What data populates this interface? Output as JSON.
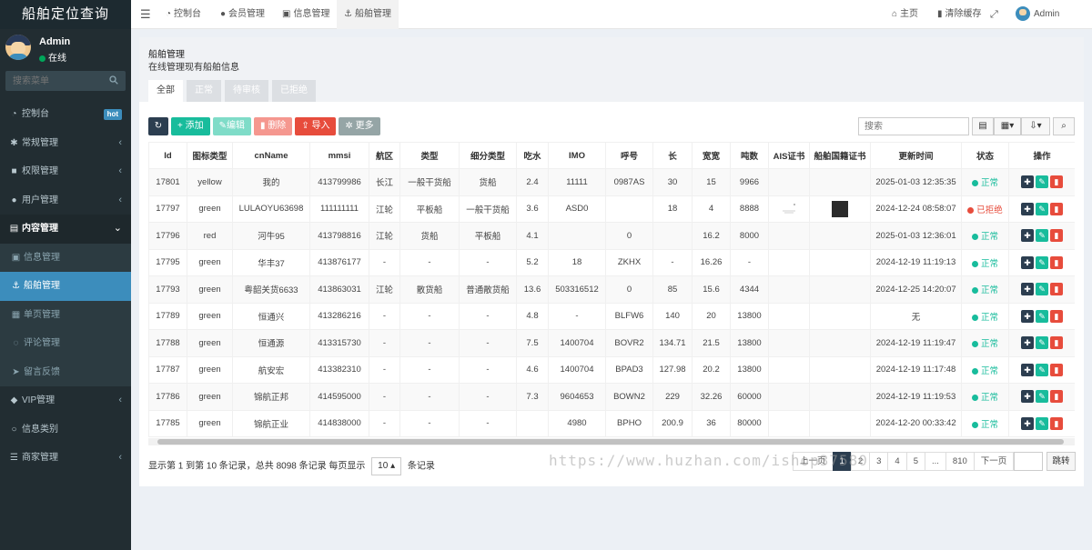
{
  "app": {
    "title": "船舶定位查询"
  },
  "user": {
    "name": "Admin",
    "status": "在线"
  },
  "sidebar": {
    "search_placeholder": "搜索菜单",
    "items": [
      {
        "label": "控制台",
        "icon": "dashboard-icon",
        "badge": "hot"
      },
      {
        "label": "常规管理",
        "icon": "cogs-icon"
      },
      {
        "label": "权限管理",
        "icon": "group-icon"
      },
      {
        "label": "用户管理",
        "icon": "user-circle-icon"
      },
      {
        "label": "内容管理",
        "icon": "file-icon"
      },
      {
        "label": "信息管理",
        "icon": "image-icon"
      },
      {
        "label": "船舶管理",
        "icon": "anchor-icon"
      },
      {
        "label": "单页管理",
        "icon": "file-text-icon"
      },
      {
        "label": "评论管理",
        "icon": "comment-icon"
      },
      {
        "label": "留言反馈",
        "icon": "paper-plane-icon"
      },
      {
        "label": "VIP管理",
        "icon": "diamond-icon"
      },
      {
        "label": "信息类别",
        "icon": "circle-icon"
      },
      {
        "label": "商家管理",
        "icon": "list-icon"
      }
    ]
  },
  "topbar": {
    "tabs": [
      "控制台",
      "会员管理",
      "信息管理",
      "船舶管理"
    ],
    "home": "主页",
    "clear_cache": "清除缓存",
    "user": "Admin"
  },
  "page": {
    "title": "船舶管理",
    "subtitle": "在线管理现有船舶信息",
    "tabs": [
      "全部",
      "正常",
      "待审核",
      "已拒绝"
    ]
  },
  "toolbar": {
    "add": "添加",
    "edit": "编辑",
    "delete": "删除",
    "import": "导入",
    "more": "更多",
    "search_placeholder": "搜索"
  },
  "table": {
    "columns": [
      "Id",
      "图标类型",
      "cnName",
      "mmsi",
      "航区",
      "类型",
      "细分类型",
      "吃水",
      "IMO",
      "呼号",
      "长",
      "宽宽",
      "吨数",
      "AIS证书",
      "船舶国籍证书",
      "更新时间",
      "状态",
      "操作"
    ],
    "rows": [
      [
        "17801",
        "yellow",
        "我的",
        "413799986",
        "长江",
        "一般干货船",
        "货船",
        "2.4",
        "11111",
        "0987AS",
        "30",
        "15",
        "9966",
        "",
        "",
        "2025-01-03 12:35:35",
        "正常"
      ],
      [
        "17797",
        "green",
        "LULAOYU63698",
        "111111111",
        "江轮",
        "平板船",
        "一般干货船",
        "3.6",
        "ASD0",
        "",
        "18",
        "4",
        "8888",
        "",
        "",
        "2024-12-24 08:58:07",
        "已拒绝"
      ],
      [
        "17796",
        "red",
        "河牛95",
        "413798816",
        "江轮",
        "货船",
        "平板船",
        "4.1",
        "",
        "0",
        "",
        "16.2",
        "8000",
        "",
        "",
        "2025-01-03 12:36:01",
        "正常"
      ],
      [
        "17795",
        "green",
        "华丰37",
        "413876177",
        "-",
        "-",
        "-",
        "5.2",
        "18",
        "ZKHX",
        "-",
        "16.26",
        "-",
        "",
        "",
        "2024-12-19 11:19:13",
        "正常"
      ],
      [
        "17793",
        "green",
        "粤韶关货6633",
        "413863031",
        "江轮",
        "散货船",
        "普通散货船",
        "13.6",
        "503316512",
        "0",
        "85",
        "15.6",
        "4344",
        "",
        "",
        "2024-12-25 14:20:07",
        "正常"
      ],
      [
        "17789",
        "green",
        "恒通兴",
        "413286216",
        "-",
        "-",
        "-",
        "4.8",
        "-",
        "BLFW6",
        "140",
        "20",
        "13800",
        "",
        "",
        "无",
        "正常"
      ],
      [
        "17788",
        "green",
        "恒通源",
        "413315730",
        "-",
        "-",
        "-",
        "7.5",
        "1400704",
        "BOVR2",
        "134.71",
        "21.5",
        "13800",
        "",
        "",
        "2024-12-19 11:19:47",
        "正常"
      ],
      [
        "17787",
        "green",
        "航安宏",
        "413382310",
        "-",
        "-",
        "-",
        "4.6",
        "1400704",
        "BPAD3",
        "127.98",
        "20.2",
        "13800",
        "",
        "",
        "2024-12-19 11:17:48",
        "正常"
      ],
      [
        "17786",
        "green",
        "锦航正邦",
        "414595000",
        "-",
        "-",
        "-",
        "7.3",
        "9604653",
        "BOWN2",
        "229",
        "32.26",
        "60000",
        "",
        "",
        "2024-12-19 11:19:53",
        "正常"
      ],
      [
        "17785",
        "green",
        "锦航正业",
        "414838000",
        "-",
        "-",
        "-",
        "",
        "4980",
        "BPHO",
        "200.9",
        "36",
        "80000",
        "",
        "",
        "2024-12-20 00:33:42",
        "正常"
      ]
    ]
  },
  "footer": {
    "info_prefix": "显示第 1 到第 10 条记录，总共 8098 条记录 每页显示",
    "page_size": "10",
    "info_suffix": "条记录",
    "pages": [
      "上一页",
      "1",
      "2",
      "3",
      "4",
      "5",
      "...",
      "810",
      "下一页"
    ],
    "jump": "跳转"
  },
  "watermark": "https://www.huzhan.com/ishop37580"
}
